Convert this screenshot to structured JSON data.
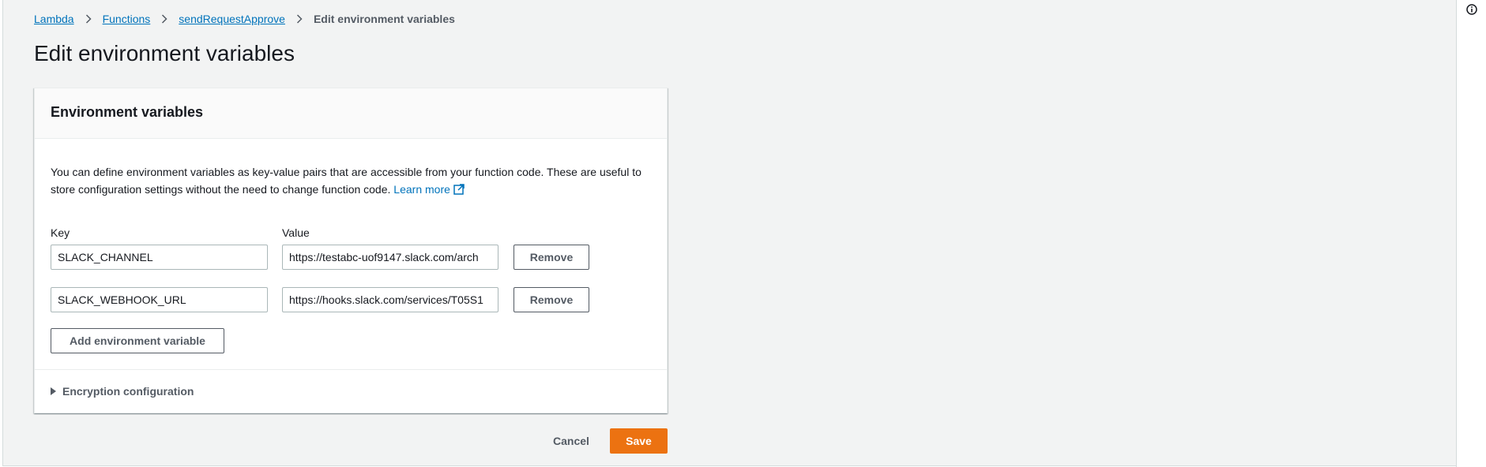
{
  "breadcrumb": {
    "items": [
      "Lambda",
      "Functions",
      "sendRequestApprove"
    ],
    "current": "Edit environment variables"
  },
  "page": {
    "title": "Edit environment variables"
  },
  "panel": {
    "title": "Environment variables",
    "description": "You can define environment variables as key-value pairs that are accessible from your function code. These are useful to store configuration settings without the need to change function code.",
    "learn_more": "Learn more",
    "key_label": "Key",
    "value_label": "Value",
    "variables": [
      {
        "key": "SLACK_CHANNEL",
        "value": "https://testabc-uof9147.slack.com/arch",
        "remove_label": "Remove"
      },
      {
        "key": "SLACK_WEBHOOK_URL",
        "value": "https://hooks.slack.com/services/T05S1",
        "remove_label": "Remove"
      }
    ],
    "add_label": "Add environment variable",
    "encryption_label": "Encryption configuration"
  },
  "actions": {
    "cancel_label": "Cancel",
    "save_label": "Save"
  },
  "icons": {
    "breadcrumb_separator": "chevron-right-icon",
    "external": "external-link-icon",
    "info": "info-icon",
    "expand": "caret-right-icon"
  },
  "colors": {
    "link": "#0073bb",
    "primary_button": "#ec7211",
    "background": "#f2f3f3",
    "text": "#16191f",
    "secondary_text": "#545b64"
  }
}
